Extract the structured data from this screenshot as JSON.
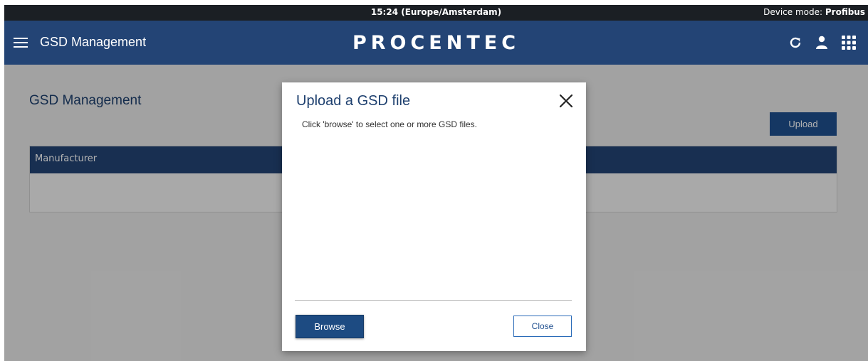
{
  "statusbar": {
    "time": "15:24 (Europe/Amsterdam)",
    "mode_label": "Device mode: ",
    "mode_value": "Profibus"
  },
  "navbar": {
    "title": "GSD Management",
    "logo": "PROCENTEC",
    "icons": [
      "menu-icon",
      "refresh-icon",
      "user-icon",
      "apps-grid-icon"
    ]
  },
  "page": {
    "title": "GSD Management",
    "upload_label": "Upload",
    "table": {
      "columns": [
        "Manufacturer"
      ],
      "rows": []
    }
  },
  "modal": {
    "title": "Upload a GSD file",
    "instruction": "Click 'browse' to select one or more GSD files.",
    "browse_label": "Browse",
    "close_label": "Close"
  },
  "colors": {
    "navbar": "#234475",
    "statusbar": "#1b1f24",
    "accent": "#1f4f8f"
  }
}
